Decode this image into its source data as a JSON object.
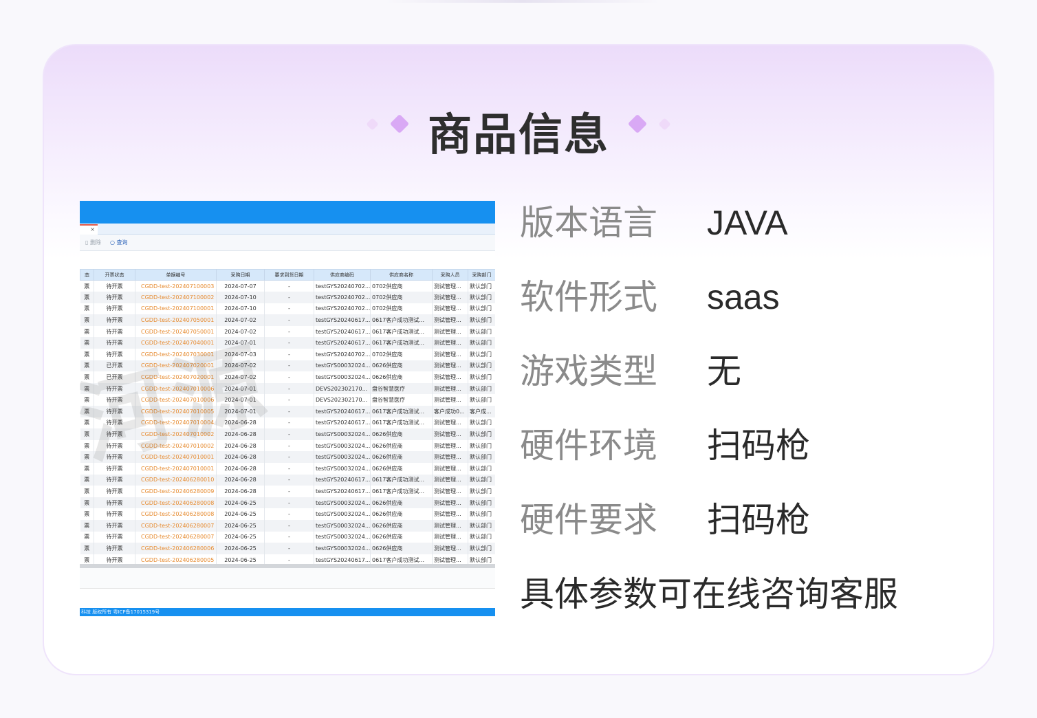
{
  "header": {
    "title": "商品信息"
  },
  "specs": [
    {
      "label": "版本语言",
      "value": "JAVA"
    },
    {
      "label": "软件形式",
      "value": "saas"
    },
    {
      "label": "游戏类型",
      "value": "无"
    },
    {
      "label": "硬件环境",
      "value": "扫码枪"
    },
    {
      "label": "硬件要求",
      "value": "扫码枪"
    }
  ],
  "note": "具体参数可在线咨询客服",
  "preview": {
    "tab_close": "×",
    "toolbar": {
      "delete_label": "删除",
      "query_label": "查询"
    },
    "columns": [
      "态",
      "开票状态",
      "单据编号",
      "采购日期",
      "要求到货日期",
      "供应商编码",
      "供应商名称",
      "采购人员",
      "采购部门"
    ],
    "rows": [
      [
        "票",
        "待开票",
        "CGDD-test-202407100003",
        "2024-07-07",
        "-",
        "testGYS20240702...",
        "0702供应商",
        "测试管理...",
        "默认部门"
      ],
      [
        "票",
        "待开票",
        "CGDD-test-202407100002",
        "2024-07-10",
        "-",
        "testGYS20240702...",
        "0702供应商",
        "测试管理...",
        "默认部门"
      ],
      [
        "票",
        "待开票",
        "CGDD-test-202407100001",
        "2024-07-10",
        "-",
        "testGYS20240702...",
        "0702供应商",
        "测试管理...",
        "默认部门"
      ],
      [
        "票",
        "待开票",
        "CGDD-test-202407050001",
        "2024-07-02",
        "-",
        "testGYS20240617...",
        "0617客户成功测试...",
        "测试管理...",
        "默认部门"
      ],
      [
        "票",
        "待开票",
        "CGDD-test-202407050001",
        "2024-07-02",
        "-",
        "testGYS20240617...",
        "0617客户成功测试...",
        "测试管理...",
        "默认部门"
      ],
      [
        "票",
        "待开票",
        "CGDD-test-202407040001",
        "2024-07-01",
        "-",
        "testGYS20240617...",
        "0617客户成功测试...",
        "测试管理...",
        "默认部门"
      ],
      [
        "票",
        "待开票",
        "CGDD-test-202407030001",
        "2024-07-03",
        "-",
        "testGYS20240702...",
        "0702供应商",
        "测试管理...",
        "默认部门"
      ],
      [
        "票",
        "已开票",
        "CGDD-test-202407020001",
        "2024-07-02",
        "-",
        "testGYS00032024...",
        "0626供应商",
        "测试管理...",
        "默认部门"
      ],
      [
        "票",
        "已开票",
        "CGDD-test-202407020001",
        "2024-07-02",
        "-",
        "testGYS00032024...",
        "0626供应商",
        "测试管理...",
        "默认部门"
      ],
      [
        "票",
        "待开票",
        "CGDD-test-202407010006",
        "2024-07-01",
        "-",
        "DEVS202302170...",
        "盘谷智慧医疗",
        "测试管理...",
        "默认部门"
      ],
      [
        "票",
        "待开票",
        "CGDD-test-202407010006",
        "2024-07-01",
        "-",
        "DEVS202302170...",
        "盘谷智慧医疗",
        "测试管理...",
        "默认部门"
      ],
      [
        "票",
        "待开票",
        "CGDD-test-202407010005",
        "2024-07-01",
        "-",
        "testGYS20240617...",
        "0617客户成功测试...",
        "客户成功0...",
        "客户成..."
      ],
      [
        "票",
        "待开票",
        "CGDD-test-202407010004",
        "2024-06-28",
        "-",
        "testGYS20240617...",
        "0617客户成功测试...",
        "测试管理...",
        "默认部门"
      ],
      [
        "票",
        "待开票",
        "CGDD-test-202407010002",
        "2024-06-28",
        "-",
        "testGYS00032024...",
        "0626供应商",
        "测试管理...",
        "默认部门"
      ],
      [
        "票",
        "待开票",
        "CGDD-test-202407010002",
        "2024-06-28",
        "-",
        "testGYS00032024...",
        "0626供应商",
        "测试管理...",
        "默认部门"
      ],
      [
        "票",
        "待开票",
        "CGDD-test-202407010001",
        "2024-06-28",
        "-",
        "testGYS00032024...",
        "0626供应商",
        "测试管理...",
        "默认部门"
      ],
      [
        "票",
        "待开票",
        "CGDD-test-202407010001",
        "2024-06-28",
        "-",
        "testGYS00032024...",
        "0626供应商",
        "测试管理...",
        "默认部门"
      ],
      [
        "票",
        "待开票",
        "CGDD-test-202406280010",
        "2024-06-28",
        "-",
        "testGYS20240617...",
        "0617客户成功测试...",
        "测试管理...",
        "默认部门"
      ],
      [
        "票",
        "待开票",
        "CGDD-test-202406280009",
        "2024-06-28",
        "-",
        "testGYS20240617...",
        "0617客户成功测试...",
        "测试管理...",
        "默认部门"
      ],
      [
        "票",
        "待开票",
        "CGDD-test-202406280008",
        "2024-06-25",
        "-",
        "testGYS00032024...",
        "0626供应商",
        "测试管理...",
        "默认部门"
      ],
      [
        "票",
        "待开票",
        "CGDD-test-202406280008",
        "2024-06-25",
        "-",
        "testGYS00032024...",
        "0626供应商",
        "测试管理...",
        "默认部门"
      ],
      [
        "票",
        "待开票",
        "CGDD-test-202406280007",
        "2024-06-25",
        "-",
        "testGYS00032024...",
        "0626供应商",
        "测试管理...",
        "默认部门"
      ],
      [
        "票",
        "待开票",
        "CGDD-test-202406280007",
        "2024-06-25",
        "-",
        "testGYS00032024...",
        "0626供应商",
        "测试管理...",
        "默认部门"
      ],
      [
        "票",
        "待开票",
        "CGDD-test-202406280006",
        "2024-06-25",
        "-",
        "testGYS00032024...",
        "0626供应商",
        "测试管理...",
        "默认部门"
      ],
      [
        "票",
        "待开票",
        "CGDD-test-202406280005",
        "2024-06-25",
        "-",
        "testGYS20240617...",
        "0617客户成功测试...",
        "测试管理...",
        "默认部门"
      ]
    ],
    "footer": "科技 版权所有    粤ICP备17015319号",
    "watermark": "河源"
  },
  "colors": {
    "accent": "#1690f0",
    "code_link": "#e68a2e",
    "diamond": "#d9a9f5",
    "card_top": "#ecdcfa"
  }
}
